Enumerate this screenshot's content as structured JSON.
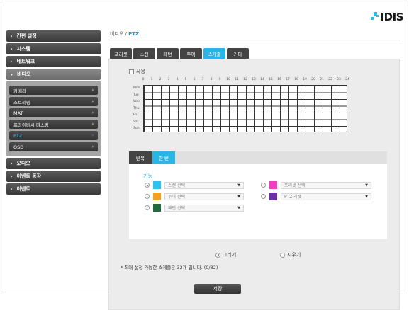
{
  "brand": {
    "logo_text": "IDIS",
    "logo_colors": [
      "#1ec3f0",
      "#2a2a2a"
    ]
  },
  "sidebar": {
    "items": [
      {
        "label": "간편 설정"
      },
      {
        "label": "시스템"
      },
      {
        "label": "네트워크"
      },
      {
        "label": "비디오"
      }
    ],
    "video_sub": [
      {
        "label": "카메라"
      },
      {
        "label": "스트리밍"
      },
      {
        "label": "MAT"
      },
      {
        "label": "프라이버시 마스킹"
      },
      {
        "label": "PTZ"
      },
      {
        "label": "OSD"
      }
    ],
    "items_after": [
      {
        "label": "오디오"
      },
      {
        "label": "이벤트 동작"
      },
      {
        "label": "이벤트"
      }
    ]
  },
  "breadcrumb": {
    "parent": "비디오 / ",
    "current": "PTZ"
  },
  "tabs": [
    {
      "label": "프리셋"
    },
    {
      "label": "스캔"
    },
    {
      "label": "패턴"
    },
    {
      "label": "투어"
    },
    {
      "label": "스케줄"
    },
    {
      "label": "기타"
    }
  ],
  "schedule": {
    "use_label": "사용",
    "hours": [
      "0",
      "1",
      "2",
      "3",
      "4",
      "5",
      "6",
      "7",
      "8",
      "9",
      "10",
      "11",
      "12",
      "13",
      "14",
      "15",
      "16",
      "17",
      "18",
      "19",
      "20",
      "21",
      "22",
      "23",
      "24"
    ],
    "days": [
      "Mon",
      "Tue",
      "Wed",
      "Thu",
      "Fri",
      "Sat",
      "Sun"
    ]
  },
  "mode_tabs": [
    {
      "label": "반복"
    },
    {
      "label": "한 번"
    }
  ],
  "function": {
    "label": "기능",
    "options": [
      {
        "placeholder": "스캔 선택",
        "color": "#2bc4f2"
      },
      {
        "placeholder": "프리셋 선택",
        "color": "#f23fbf"
      },
      {
        "placeholder": "투어 선택",
        "color": "#f5a11e"
      },
      {
        "placeholder": "PTZ 리셋",
        "color": "#6b2fa6"
      },
      {
        "placeholder": "패턴 선택",
        "color": "#1f6b3d"
      }
    ]
  },
  "draw": {
    "draw_label": "그리기",
    "erase_label": "지우기"
  },
  "note": "* 최대 설정 가능한 스케줄은 32개 입니다. (0/32)",
  "save_label": "저장"
}
